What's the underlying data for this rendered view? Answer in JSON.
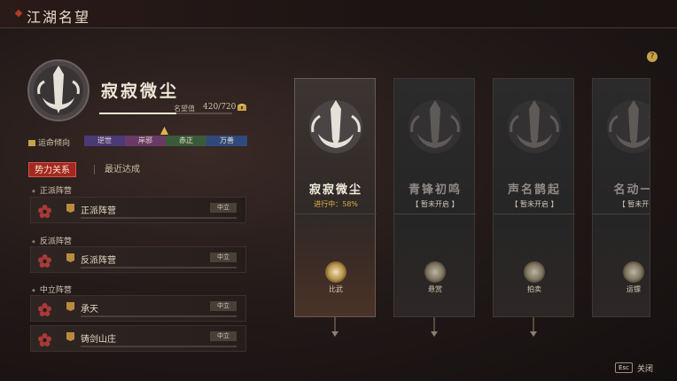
{
  "header": {
    "title": "江湖名望"
  },
  "player": {
    "name": "寂寂微尘",
    "reputation_label": "名望值",
    "reputation_value": "420/720",
    "reputation_progress": 0.583
  },
  "fate": {
    "label": "运命倾向",
    "segments": [
      "逆世",
      "岸邪",
      "赤正",
      "万善"
    ],
    "segment_colors": [
      "#4a3a78",
      "#6a3a66",
      "#3a5a3a",
      "#2f4a7a"
    ]
  },
  "tabs": {
    "faction": "势力关系",
    "recent": "最近达成"
  },
  "groups": [
    {
      "label": "正派阵营",
      "rows": [
        {
          "name": "正派阵营",
          "status": "中立"
        }
      ]
    },
    {
      "label": "反派阵营",
      "rows": [
        {
          "name": "反派阵营",
          "status": "中立"
        }
      ]
    },
    {
      "label": "中立阵营",
      "rows": [
        {
          "name": "承天",
          "status": "中立"
        },
        {
          "name": "铸剑山庄",
          "status": "中立"
        }
      ]
    }
  ],
  "banners": [
    {
      "name": "寂寂微尘",
      "status": "进行中：58%",
      "activity": "比武",
      "active": true
    },
    {
      "name": "青锋初鸣",
      "status": "【 暂未开启 】",
      "activity": "悬赏",
      "active": false
    },
    {
      "name": "声名鹊起",
      "status": "【 暂未开启 】",
      "activity": "拍卖",
      "active": false
    },
    {
      "name": "名动一",
      "status": "【 暂未开",
      "activity": "运镖",
      "active": false
    }
  ],
  "footer": {
    "esc_key": "Esc",
    "close_label": "关闭"
  },
  "help_icon": "?"
}
